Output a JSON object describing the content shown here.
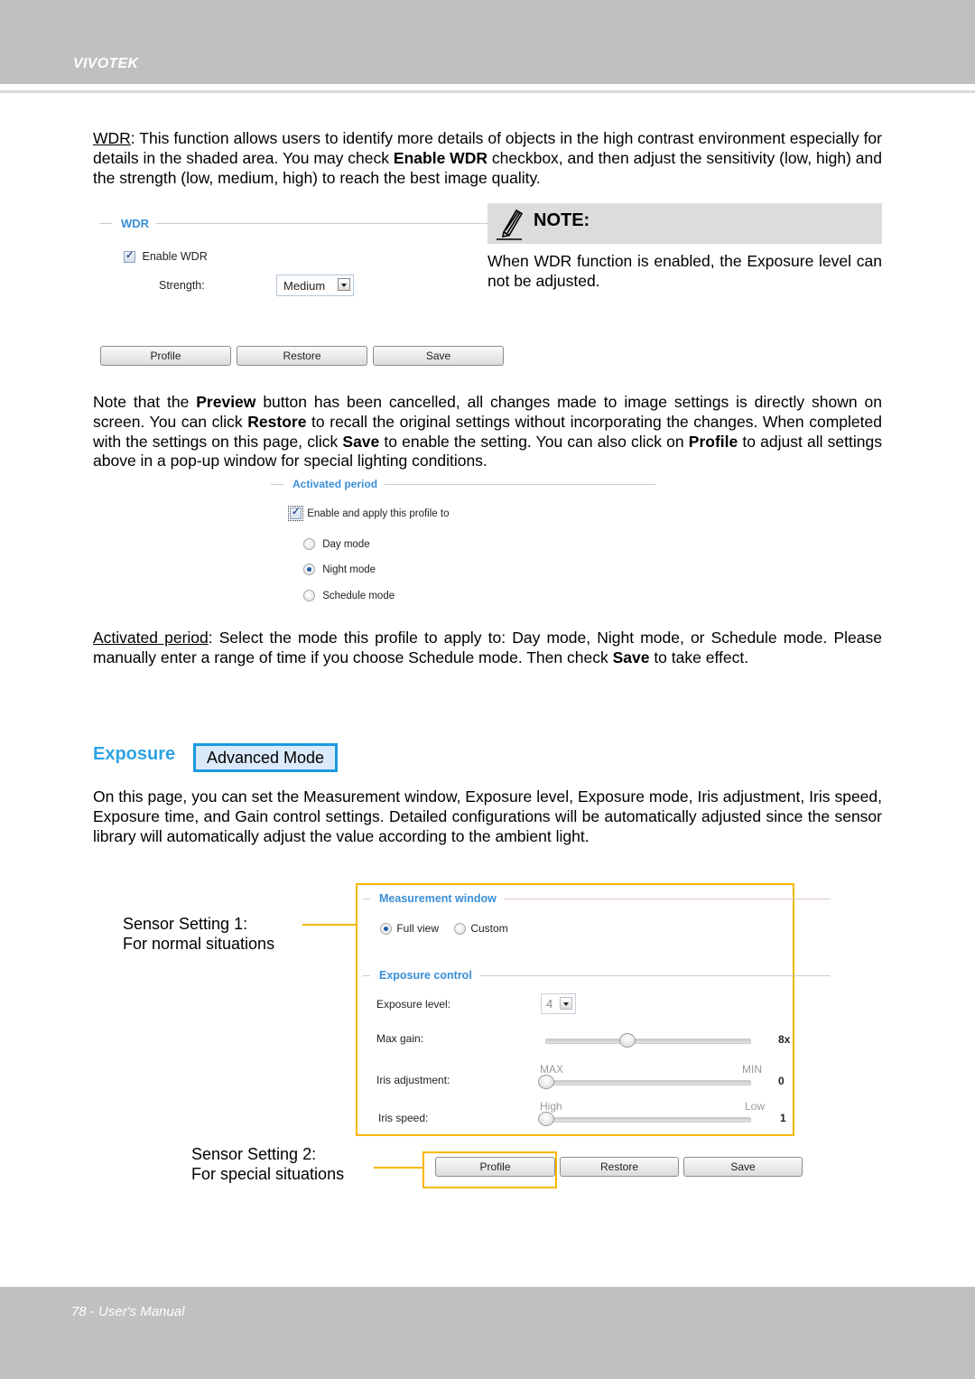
{
  "header": {
    "brand": "VIVOTEK"
  },
  "footer": {
    "page_label": "78 - User's Manual"
  },
  "wdr_paragraph": {
    "term": "WDR",
    "text_1": ": This function allows users to identify more details of objects in the high contrast environment especially for details in the shaded area. You may check ",
    "bold_1": "Enable WDR",
    "text_2": " checkbox, and then adjust the sensitivity (low, high) and the strength (low, medium, high) to reach the best image quality."
  },
  "wdr_panel": {
    "legend": "WDR",
    "enable_label": "Enable WDR",
    "enable_checked": true,
    "strength_label": "Strength:",
    "strength_value": "Medium",
    "buttons": [
      "Profile",
      "Restore",
      "Save"
    ]
  },
  "note": {
    "title": "NOTE:",
    "text": "When WDR function is enabled, the Exposure level can not be adjusted."
  },
  "preview_paragraph": {
    "t1": "Note that the ",
    "b1": "Preview",
    "t2": " button has been cancelled, all changes made to image settings is directly shown on screen. You can click ",
    "b2": "Restore",
    "t3": " to recall the original settings without incorporating the changes. When completed with the settings on this page, click ",
    "b3": "Save",
    "t4": " to enable the setting. You can also click on ",
    "b4": "Profile",
    "t5": " to adjust all settings above in a pop-up window for special lighting conditions."
  },
  "activated_period_panel": {
    "legend": "Activated period",
    "enable_label": "Enable and apply this profile to",
    "enable_checked": true,
    "modes": [
      {
        "label": "Day mode",
        "selected": false
      },
      {
        "label": "Night mode",
        "selected": true
      },
      {
        "label": "Schedule mode",
        "selected": false
      }
    ]
  },
  "activated_paragraph": {
    "term": "Activated period",
    "t1": ": Select the mode this profile to apply to: Day mode, Night mode, or Schedule mode. Please manually enter a range of time if you choose Schedule mode. Then check ",
    "b1": "Save",
    "t2": " to take effect."
  },
  "exposure": {
    "title": "Exposure",
    "mode_badge": "Advanced Mode",
    "paragraph": "On this page, you can set the Measurement window, Exposure level, Exposure mode, Iris adjustment, Iris speed, Exposure time, and Gain control settings. Detailed configurations will be automatically adjusted since the sensor library will automatically adjust the value according to the ambient light."
  },
  "exposure_panel": {
    "measurement_legend": "Measurement window",
    "measurement_options": [
      {
        "label": "Full view",
        "selected": true
      },
      {
        "label": "Custom",
        "selected": false
      }
    ],
    "control_legend": "Exposure control",
    "exposure_level_label": "Exposure level:",
    "exposure_level_value": "4",
    "max_gain": {
      "label": "Max gain:",
      "value": "8x",
      "position": 0.4
    },
    "iris_adjustment": {
      "label": "Iris adjustment:",
      "min_label": "MAX",
      "max_label": "MIN",
      "value": "0",
      "position": 0.0
    },
    "iris_speed": {
      "label": "Iris speed:",
      "min_label": "High",
      "max_label": "Low",
      "value": "1",
      "position": 0.0
    },
    "buttons": [
      "Profile",
      "Restore",
      "Save"
    ]
  },
  "annotations": {
    "sensor1_title": "Sensor Setting 1:",
    "sensor1_desc": "For normal situations",
    "sensor2_title": "Sensor Setting 2:",
    "sensor2_desc": "For special situations"
  },
  "colors": {
    "legend_blue": "#3a8fd6",
    "exposure_blue": "#2ea3e0",
    "highlight_yellow": "#f5b700",
    "header_grey": "#bfc0bf"
  }
}
